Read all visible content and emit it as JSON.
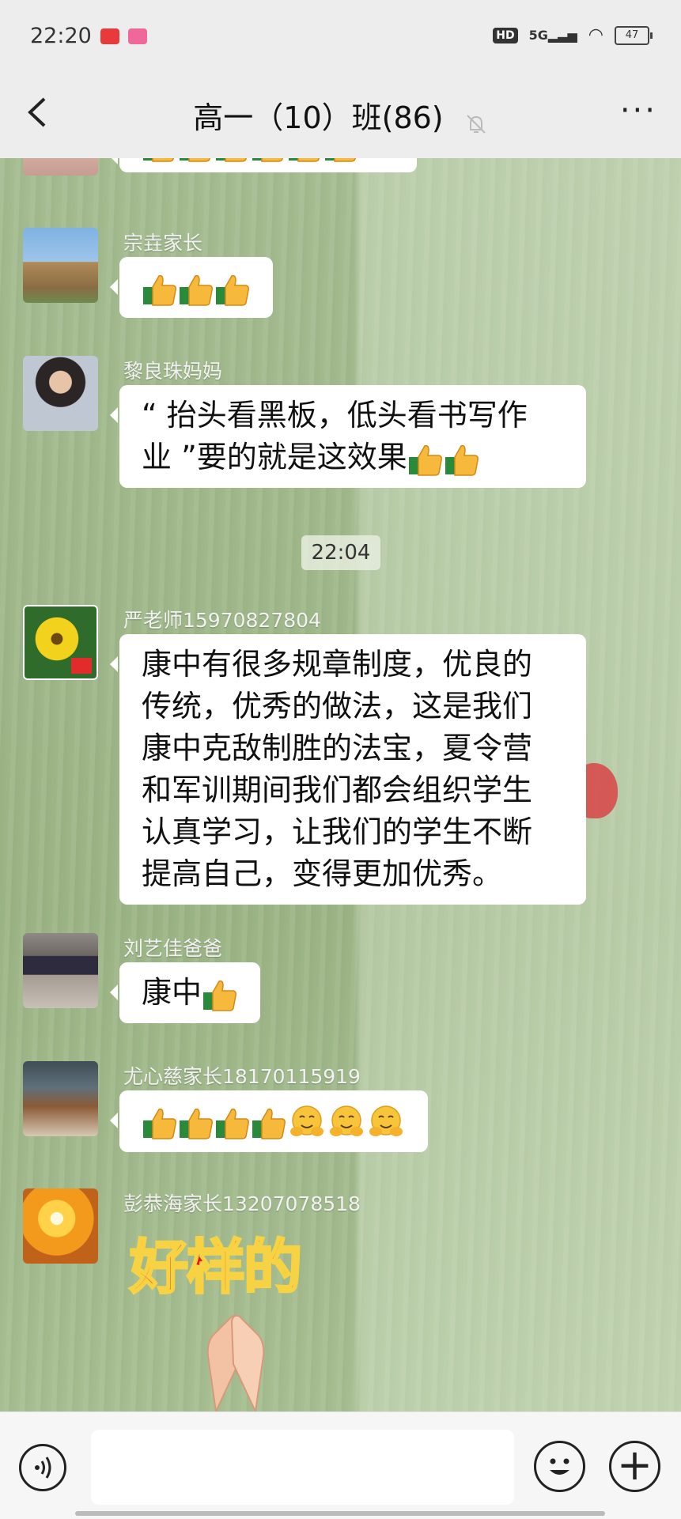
{
  "status_bar": {
    "time": "22:20",
    "network": "5G",
    "battery": "47"
  },
  "header": {
    "title": "高一（10）班(86)"
  },
  "chat": {
    "time_divider": "22:04",
    "messages": [
      {
        "sender": "",
        "text": ""
      },
      {
        "sender": "宗垚家长",
        "text": ""
      },
      {
        "sender": "黎良珠妈妈",
        "text_line1": "“ 抬头看黑板，低头看书写作",
        "text_line2": "业 ”要的就是这效果"
      },
      {
        "sender": "严老师15970827804",
        "lines": [
          "康中有很多规章制度，优良的",
          "传统，优秀的做法，这是我们",
          "康中克敌制胜的法宝，夏令营",
          "和军训期间我们都会组织学生",
          "认真学习，让我们的学生不断",
          "提高自己，变得更加优秀。"
        ]
      },
      {
        "sender": "刘艺佳爸爸",
        "text": "康中"
      },
      {
        "sender": "尤心慈家长18170115919",
        "text": ""
      },
      {
        "sender": "彭恭海家长13207078518",
        "sticker_text": "好样的"
      }
    ]
  },
  "icons": {
    "thumb": "thumbs-up-icon",
    "hug": "hugging-face-icon",
    "back": "back-arrow-icon",
    "mute": "muted-bell-icon",
    "more": "more-icon",
    "voice": "voice-icon",
    "emoji": "emoji-icon",
    "plus": "plus-icon"
  }
}
